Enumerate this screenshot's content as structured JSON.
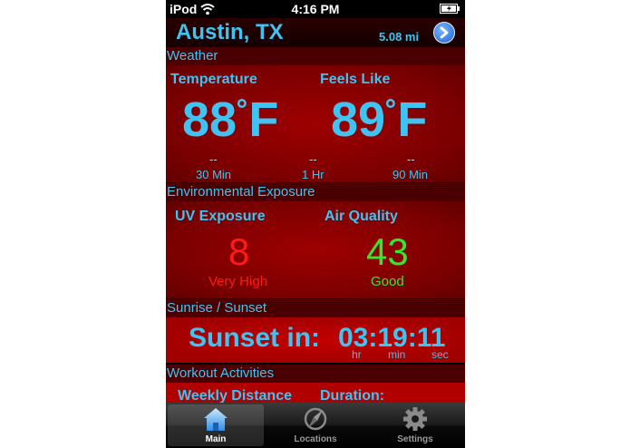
{
  "status_bar": {
    "carrier": "iPod",
    "time": "4:16 PM"
  },
  "location": {
    "city": "Austin, TX",
    "distance": "5.08 mi"
  },
  "weather": {
    "section_title": "Weather",
    "temperature_label": "Temperature",
    "temperature_value": "88",
    "feels_like_label": "Feels Like",
    "feels_like_value": "89",
    "degree_symbol": "˚",
    "unit": "F",
    "forecasts": [
      {
        "value": "--",
        "label": "30 Min"
      },
      {
        "value": "--",
        "label": "1 Hr"
      },
      {
        "value": "--",
        "label": "90 Min"
      }
    ]
  },
  "environment": {
    "section_title": "Environmental Exposure",
    "uv_label": "UV Exposure",
    "uv_value": "8",
    "uv_desc": "Very High",
    "air_label": "Air Quality",
    "air_value": "43",
    "air_desc": "Good",
    "colors": {
      "uv": "#ff1a1a",
      "air": "#33e62e"
    }
  },
  "sun": {
    "section_title": "Sunrise / Sunset",
    "label": "Sunset in:",
    "countdown": "03:19:11",
    "units": {
      "hr": "hr",
      "min": "min",
      "sec": "sec"
    }
  },
  "workout": {
    "section_title": "Workout Activities",
    "weekly_distance_label": "Weekly Distance",
    "duration_label": "Duration:"
  },
  "tabs": [
    {
      "label": "Main",
      "icon": "home-icon",
      "active": true
    },
    {
      "label": "Locations",
      "icon": "compass-icon",
      "active": false
    },
    {
      "label": "Settings",
      "icon": "gear-icon",
      "active": false
    }
  ]
}
